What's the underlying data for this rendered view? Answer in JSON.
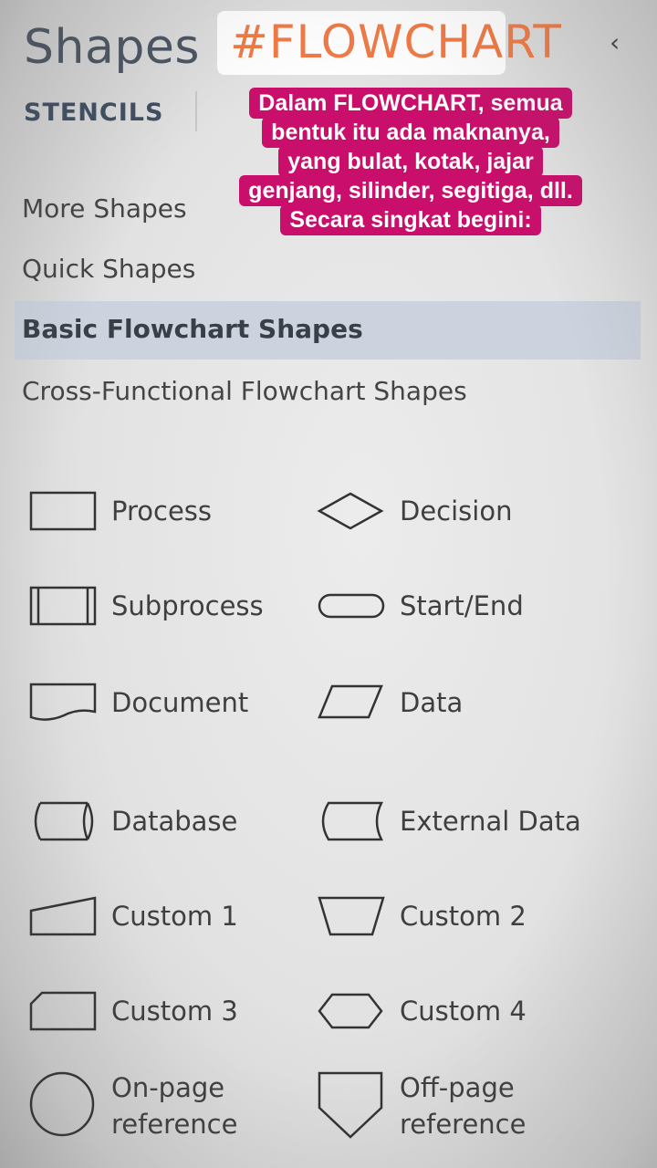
{
  "pane": {
    "title": "Shapes",
    "collapse_icon": "‹",
    "stencils_label": "STENCILS"
  },
  "menu": {
    "more_shapes": "More Shapes",
    "quick_shapes": "Quick Shapes",
    "selected": "Basic Flowchart Shapes",
    "cross_functional": "Cross-Functional Flowchart Shapes"
  },
  "shapes": [
    {
      "label": "Process",
      "icon": "process-icon"
    },
    {
      "label": "Decision",
      "icon": "decision-icon"
    },
    {
      "label": "Subprocess",
      "icon": "subprocess-icon"
    },
    {
      "label": "Start/End",
      "icon": "start-end-icon"
    },
    {
      "label": "Document",
      "icon": "document-icon"
    },
    {
      "label": "Data",
      "icon": "data-icon"
    },
    {
      "label": "Database",
      "icon": "database-icon"
    },
    {
      "label": "External Data",
      "icon": "external-data-icon"
    },
    {
      "label": "Custom 1",
      "icon": "custom-1-icon"
    },
    {
      "label": "Custom 2",
      "icon": "custom-2-icon"
    },
    {
      "label": "Custom 3",
      "icon": "custom-3-icon"
    },
    {
      "label": "Custom 4",
      "icon": "custom-4-icon"
    },
    {
      "label_line1": "On-page",
      "label_line2": "reference",
      "icon": "on-page-reference-icon"
    },
    {
      "label_line1": "Off-page",
      "label_line2": "reference",
      "icon": "off-page-reference-icon"
    }
  ],
  "overlay": {
    "hashtag": "#FLOWCHART",
    "hashtag_color": "#f07a45",
    "banner_color": "#c90f6b",
    "banner_lines": [
      "Dalam FLOWCHART, semua",
      "bentuk itu ada maknanya,",
      "yang bulat, kotak, jajar",
      "genjang, silinder, segitiga, dll.",
      "Secara singkat begini:"
    ]
  }
}
